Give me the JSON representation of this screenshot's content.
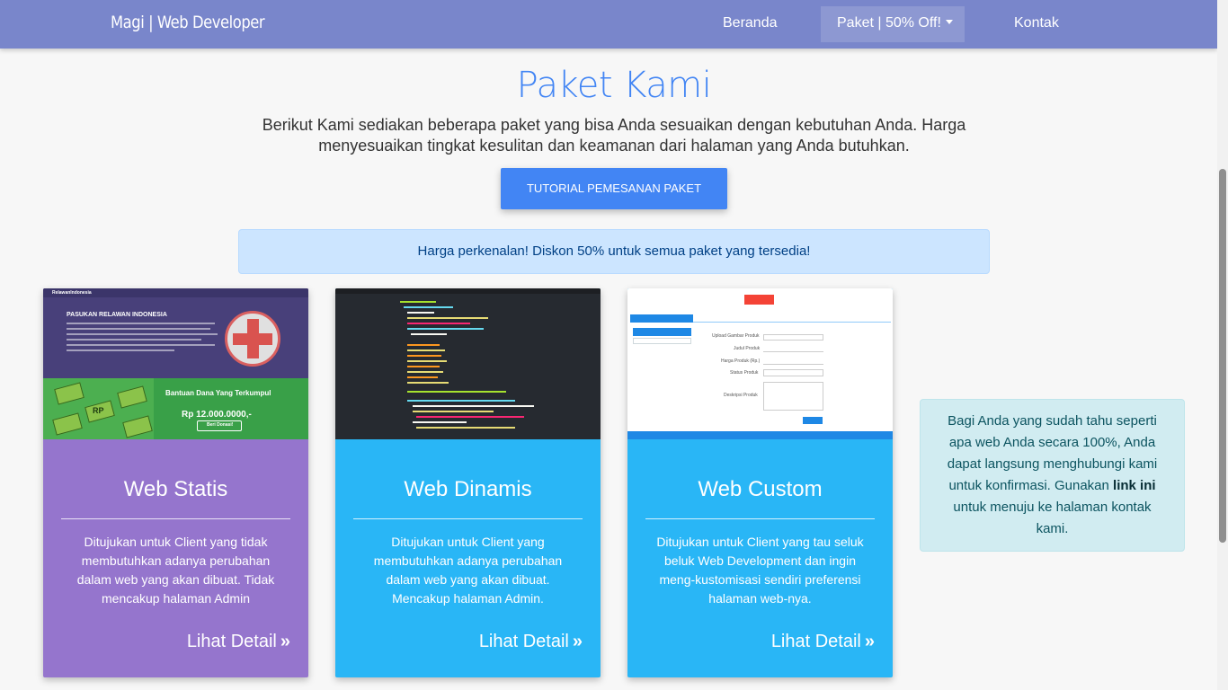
{
  "navbar": {
    "brand": "Magi | Web Developer",
    "links": [
      "Beranda",
      "Paket | 50% Off!",
      "Kontak"
    ]
  },
  "header": {
    "title": "Paket Kami",
    "lead": "Berikut Kami sediakan beberapa paket yang bisa Anda sesuaikan dengan kebutuhan Anda. Harga menyesuaikan tingkat kesulitan dan keamanan dari halaman yang Anda butuhkan.",
    "tutorial_button": "TUTORIAL PEMESANAN PAKET"
  },
  "promo_alert": "Harga perkenalan! Diskon 50% untuk semua paket yang tersedia!",
  "cards": [
    {
      "title": "Web Statis",
      "description": "Ditujukan untuk Client yang tidak membutuhkan adanya perubahan dalam web yang akan dibuat. Tidak mencakup halaman Admin",
      "more": "Lihat Detail",
      "color": "#9575cd",
      "thumb": {
        "nav_brand": "RelawanIndonesia",
        "heading": "PASUKAN RELAWAN INDONESIA",
        "fund_title": "Bantuan Dana Yang Terkumpul",
        "fund_amount": "Rp 12.000.0000,-",
        "donate_button": "Beri Donasi!",
        "money_label": "RP"
      }
    },
    {
      "title": "Web Dinamis",
      "description": "Ditujukan untuk Client yang membutuhkan adanya perubahan dalam web yang akan dibuat. Mencakup halaman Admin.",
      "more": "Lihat Detail",
      "color": "#29b6f6"
    },
    {
      "title": "Web Custom",
      "description": "Ditujukan untuk Client yang tau seluk beluk Web Development dan ingin meng-kustomisasi sendiri preferensi halaman web-nya.",
      "more": "Lihat Detail",
      "color": "#29b6f6",
      "thumb": {
        "fields": [
          "Upload Gambar Produk",
          "Judul Produk",
          "Harga Produk (Rp.)",
          "Status Produk",
          "Deskripsi Produk"
        ]
      }
    }
  ],
  "info_box": {
    "text_before": "Bagi Anda yang sudah tahu seperti apa web Anda secara 100%, Anda dapat langsung menghubungi kami untuk konfirmasi. Gunakan ",
    "link": "link ini",
    "text_after": " untuk menuju ke halaman kontak kami."
  }
}
